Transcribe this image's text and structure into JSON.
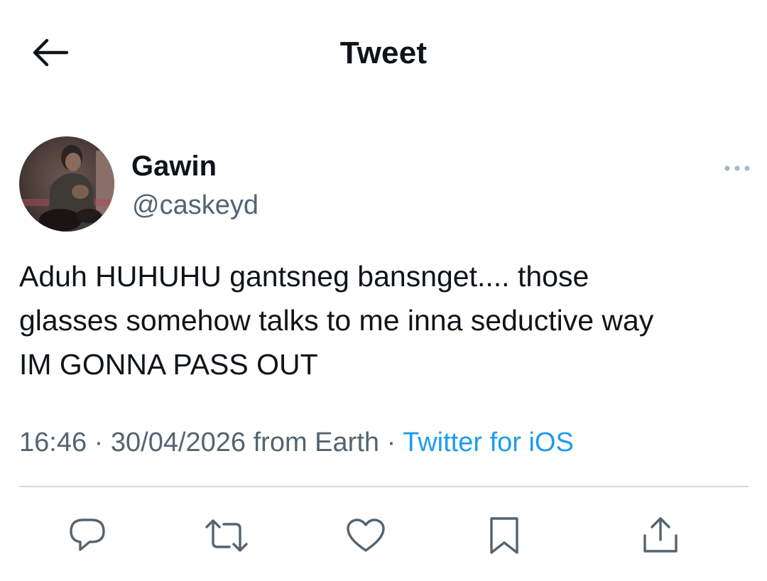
{
  "header": {
    "title": "Tweet",
    "back_icon": "arrow-left-icon"
  },
  "author": {
    "display_name": "Gawin",
    "handle": "@caskeyd"
  },
  "tweet": {
    "lines": [
      "Aduh HUHUHU gantsneg bansnget.... those",
      "glasses somehow talks to me inna seductive way",
      "IM GONNA PASS OUT"
    ],
    "time": "16:46",
    "separator": "·",
    "date": "30/04/2026",
    "location_text": "from Earth",
    "source": "Twitter for iOS"
  },
  "actions": [
    {
      "name": "reply",
      "icon": "reply-icon"
    },
    {
      "name": "retweet",
      "icon": "retweet-icon"
    },
    {
      "name": "like",
      "icon": "heart-icon"
    },
    {
      "name": "bookmark",
      "icon": "bookmark-icon"
    },
    {
      "name": "share",
      "icon": "share-icon"
    }
  ],
  "colors": {
    "text_primary": "#0f1419",
    "text_secondary": "#536471",
    "link": "#1d9bf0",
    "divider": "#cfd9de"
  }
}
